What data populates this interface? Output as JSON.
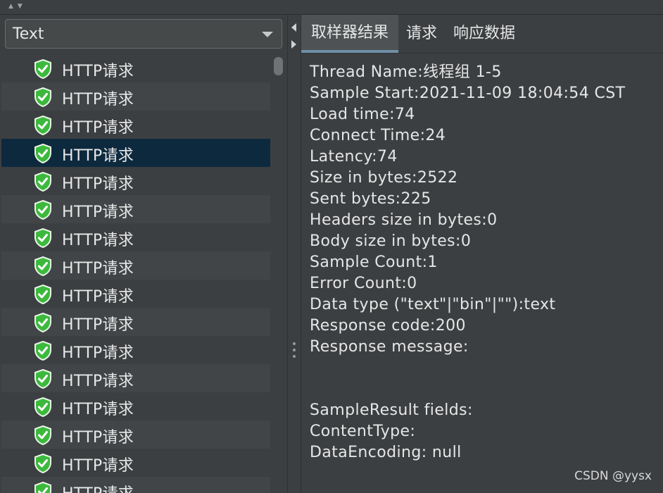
{
  "filter": {
    "selected": "Text"
  },
  "tree": {
    "items": [
      {
        "label": "HTTP请求"
      },
      {
        "label": "HTTP请求"
      },
      {
        "label": "HTTP请求"
      },
      {
        "label": "HTTP请求"
      },
      {
        "label": "HTTP请求"
      },
      {
        "label": "HTTP请求"
      },
      {
        "label": "HTTP请求"
      },
      {
        "label": "HTTP请求"
      },
      {
        "label": "HTTP请求"
      },
      {
        "label": "HTTP请求"
      },
      {
        "label": "HTTP请求"
      },
      {
        "label": "HTTP请求"
      },
      {
        "label": "HTTP请求"
      },
      {
        "label": "HTTP请求"
      },
      {
        "label": "HTTP请求"
      },
      {
        "label": "HTTP请求"
      }
    ],
    "selected_index": 3,
    "icon": "success-shield-icon",
    "icon_color": "#3cb93c"
  },
  "tabs": [
    {
      "label": "取样器结果"
    },
    {
      "label": "请求"
    },
    {
      "label": "响应数据"
    }
  ],
  "result": {
    "lines": [
      "Thread Name:线程组 1-5",
      "Sample Start:2021-11-09 18:04:54 CST",
      "Load time:74",
      "Connect Time:24",
      "Latency:74",
      "Size in bytes:2522",
      "Sent bytes:225",
      "Headers size in bytes:0",
      "Body size in bytes:0",
      "Sample Count:1",
      "Error Count:0",
      "Data type (\"text\"|\"bin\"|\"\"):text",
      "Response code:200",
      "Response message:",
      "",
      "",
      "SampleResult fields:",
      "ContentType:",
      "DataEncoding: null"
    ]
  },
  "watermark": "CSDN @yysx",
  "colors": {
    "background": "#3c3f41",
    "selected_row": "#0d293e",
    "alt_row": "#414547",
    "active_tab": "#4e5254"
  }
}
